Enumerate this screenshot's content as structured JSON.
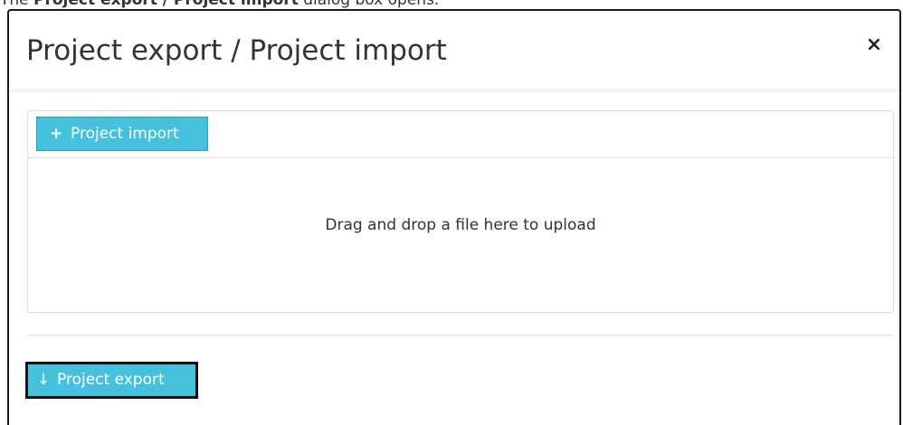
{
  "caption": {
    "prefix": "The ",
    "bold": "Project export / Project import",
    "suffix": " dialog box opens."
  },
  "dialog": {
    "title": "Project export / Project import",
    "close_icon": "×"
  },
  "import": {
    "icon": "+",
    "label": "Project import",
    "drop_text": "Drag and drop a file here to upload"
  },
  "export": {
    "icon": "↓",
    "label": "Project export"
  },
  "colors": {
    "button_bg": "#45c1dd",
    "button_text": "#ffffff",
    "highlight_border": "#111111"
  }
}
